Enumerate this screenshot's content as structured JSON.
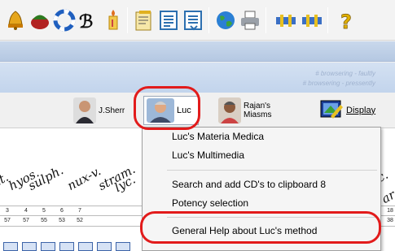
{
  "toolbar": {
    "icons": [
      "bell-icon",
      "fruit-icon",
      "lifebuoy-icon",
      "b-letter-icon",
      "candle-icon",
      "open-book-icon",
      "list-document-icon",
      "list-document-alt-icon",
      "globe-icon",
      "printer-icon",
      "plug-icon",
      "plug-alt-icon",
      "help-icon"
    ],
    "help_glyph": "?"
  },
  "band_faint_text": [
    "# browsering - faultly",
    "# browsering - pressently"
  ],
  "authors": {
    "jsher": {
      "label": "J.Sherr"
    },
    "luc": {
      "label": "Luc"
    },
    "rajan": {
      "label_line1": "Rajan's",
      "label_line2": "Miasms"
    },
    "display": {
      "label": "Display"
    }
  },
  "remedy_headers": [
    "at.",
    "hyos.",
    "sulph.",
    "nux-v.",
    "stram.",
    "lyc.",
    "c.",
    "ar"
  ],
  "column_numbers": [
    "3",
    "4",
    "5",
    "6",
    "7"
  ],
  "column_scores": [
    "57",
    "57",
    "55",
    "53",
    "52"
  ],
  "right_edge_numbers": [
    "18",
    "38"
  ],
  "context_menu": {
    "items": [
      "Luc's Materia Medica",
      "Luc's Multimedia",
      "Search and add CD's to clipboard 8",
      "Potency selection",
      "General Help about Luc's method"
    ]
  },
  "colors": {
    "highlight_ring": "#e21b1b",
    "band": "#c9d8ec",
    "menu_bg": "#f5f5f5"
  }
}
